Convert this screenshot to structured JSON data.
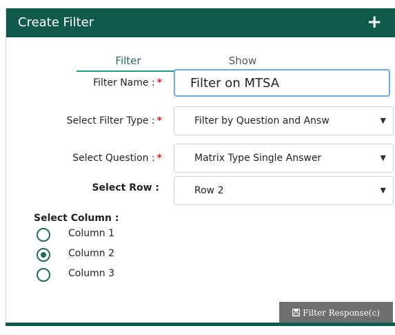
{
  "header": {
    "title": "Create Filter",
    "add_icon": "plus-icon"
  },
  "tabs": [
    {
      "label": "Filter",
      "active": true
    },
    {
      "label": "Show",
      "active": false
    }
  ],
  "form": {
    "filter_name": {
      "label": "Filter Name :",
      "required_mark": "*",
      "value": "Filter on MTSA"
    },
    "filter_type": {
      "label": "Select Filter Type :",
      "required_mark": "*",
      "selected": "Filter by Question and Answ"
    },
    "question": {
      "label": "Select Question :",
      "required_mark": "*",
      "selected": "Matrix Type Single Answer"
    },
    "row": {
      "label": "Select Row :",
      "selected": "Row 2"
    },
    "column": {
      "label": "Select Column :",
      "options": [
        {
          "label": "Column 1",
          "checked": false
        },
        {
          "label": "Column 2",
          "checked": true
        },
        {
          "label": "Column 3",
          "checked": false
        }
      ]
    }
  },
  "actions": {
    "filter_response_label": "Filter Response(c)",
    "filter_response_icon": "floppy-disk-icon"
  },
  "colors": {
    "header_bg": "#0f5a4a",
    "accent": "#16a085",
    "radio": "#1c6b58",
    "required": "#e02020",
    "button_bg": "#6f6f6f"
  }
}
